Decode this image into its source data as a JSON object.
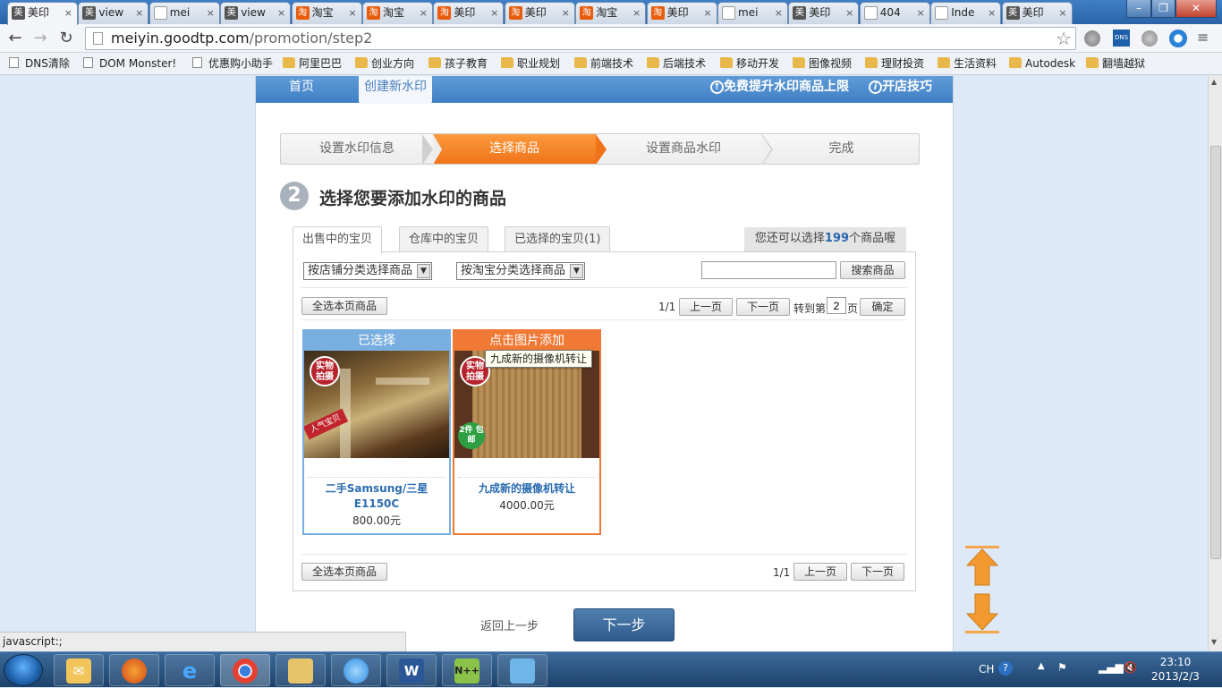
{
  "browser": {
    "tabs": [
      {
        "label": "美印",
        "favicon": "mei",
        "active": true
      },
      {
        "label": "view",
        "favicon": "mei"
      },
      {
        "label": "mei",
        "favicon": "doc"
      },
      {
        "label": "view",
        "favicon": "mei"
      },
      {
        "label": "淘宝",
        "favicon": "tao"
      },
      {
        "label": "淘宝",
        "favicon": "tao"
      },
      {
        "label": "美印",
        "favicon": "tao"
      },
      {
        "label": "美印",
        "favicon": "tao"
      },
      {
        "label": "淘宝",
        "favicon": "tao"
      },
      {
        "label": "美印",
        "favicon": "tao"
      },
      {
        "label": "mei",
        "favicon": "doc"
      },
      {
        "label": "美印",
        "favicon": "mei"
      },
      {
        "label": "404",
        "favicon": "doc"
      },
      {
        "label": "Inde",
        "favicon": "doc"
      },
      {
        "label": "美印",
        "favicon": "mei"
      }
    ],
    "tab_close": "×",
    "url_host": "meiyin.goodtp.com",
    "url_path": "/promotion/step2",
    "bookmarks": [
      {
        "label": "DNS清除",
        "icon": "page"
      },
      {
        "label": "DOM Monster!",
        "icon": "page"
      },
      {
        "label": "优惠购小助手",
        "icon": "page"
      },
      {
        "label": "阿里巴巴",
        "icon": "folder"
      },
      {
        "label": "创业方向",
        "icon": "folder"
      },
      {
        "label": "孩子教育",
        "icon": "folder"
      },
      {
        "label": "职业规划",
        "icon": "folder"
      },
      {
        "label": "前端技术",
        "icon": "folder"
      },
      {
        "label": "后端技术",
        "icon": "folder"
      },
      {
        "label": "移动开发",
        "icon": "folder"
      },
      {
        "label": "图像视频",
        "icon": "folder"
      },
      {
        "label": "理财投资",
        "icon": "folder"
      },
      {
        "label": "生活资料",
        "icon": "folder"
      },
      {
        "label": "Autodesk",
        "icon": "folder"
      },
      {
        "label": "翻墙越狱",
        "icon": "folder"
      }
    ],
    "status_text": "javascript:;"
  },
  "site": {
    "nav": {
      "home": "首页",
      "create": "创建新水印",
      "upgrade": "免费提升水印商品上限",
      "tips": "开店技巧"
    },
    "steps": [
      "设置水印信息",
      "选择商品",
      "设置商品水印",
      "完成"
    ],
    "active_step": 1,
    "heading_number": "2",
    "heading": "选择您要添加水印的商品",
    "tabs": {
      "on_sale": "出售中的宝贝",
      "in_stock": "仓库中的宝贝",
      "selected": "已选择的宝贝(1)"
    },
    "remaining_prefix": "您还可以选择",
    "remaining_count": "199",
    "remaining_suffix": "个商品喔",
    "filter_shop": "按店铺分类选择商品",
    "filter_taobao": "按淘宝分类选择商品",
    "search_value": "",
    "search_button": "搜索商品",
    "select_all": "全选本页商品",
    "page_info": "1/1",
    "prev": "上一页",
    "next": "下一页",
    "goto_prefix": "转到第",
    "goto_value": "2",
    "goto_suffix": "页",
    "confirm": "确定",
    "products": [
      {
        "badge": "已选择",
        "badge_color": "#79aee0",
        "name": "二手Samsung/三星 E1150C",
        "price": "800.00元",
        "stamp": "实物 拍摄",
        "tag": "人气宝贝"
      },
      {
        "badge": "点击图片添加",
        "badge_color": "#f07a35",
        "name": "九成新的摄像机转让",
        "price": "4000.00元",
        "stamp": "实物 拍摄",
        "tag": "2件 包邮"
      }
    ],
    "tooltip": "九成新的摄像机转让",
    "back": "返回上一步",
    "next_step": "下一步"
  },
  "taskbar": {
    "lang": "CH",
    "time": "23:10",
    "date": "2013/2/3"
  }
}
